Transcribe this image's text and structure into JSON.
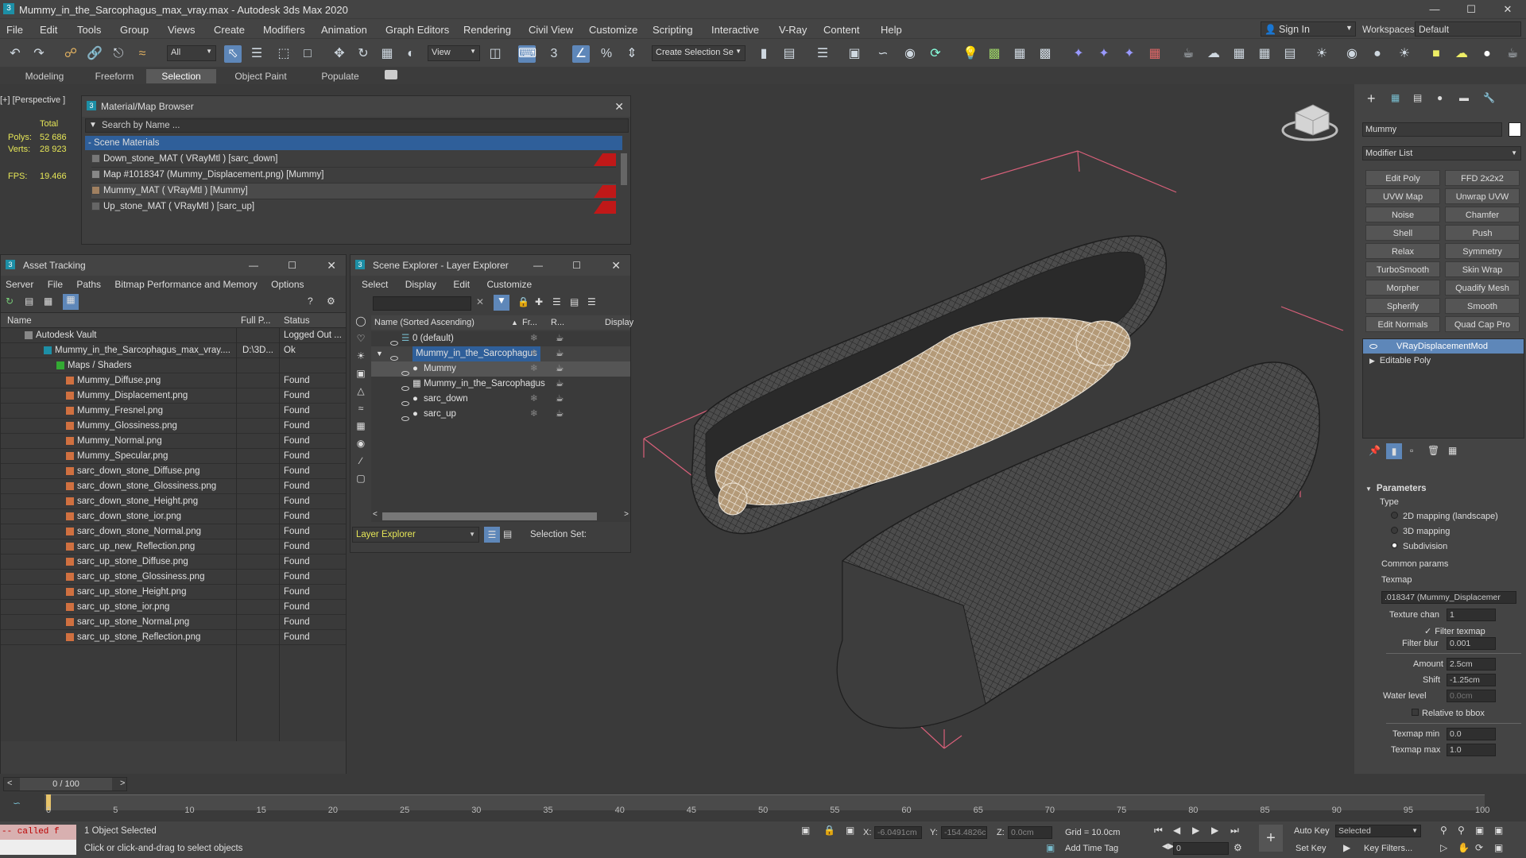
{
  "app": {
    "title": "Mummy_in_the_Sarcophagus_max_vray.max - Autodesk 3ds Max 2020"
  },
  "menu": [
    "File",
    "Edit",
    "Tools",
    "Group",
    "Views",
    "Create",
    "Modifiers",
    "Animation",
    "Graph Editors",
    "Rendering",
    "Civil View",
    "Customize",
    "Scripting",
    "Interactive",
    "V-Ray",
    "Content",
    "Help"
  ],
  "account": {
    "sign_in": "Sign In",
    "workspaces_label": "Workspaces:",
    "workspace": "Default"
  },
  "toolbar": {
    "filter": "All",
    "ref_coord": "View",
    "selection_set": "Create Selection Se"
  },
  "ribbon_tabs": [
    "Modeling",
    "Freeform",
    "Selection",
    "Object Paint",
    "Populate"
  ],
  "viewport": {
    "label": "[+] [Perspective ]",
    "stats": {
      "total": "Total",
      "polys_label": "Polys:",
      "polys": "52 686",
      "verts_label": "Verts:",
      "verts": "28 923",
      "fps_label": "FPS:",
      "fps": "19.466"
    }
  },
  "material_browser": {
    "title": "Material/Map Browser",
    "search_placeholder": "Search by Name ...",
    "group": "- Scene Materials",
    "items": [
      "Down_stone_MAT  ( VRayMtl ) [sarc_down]",
      "Map #1018347 (Mummy_Displacement.png) [Mummy]",
      "Mummy_MAT  ( VRayMtl ) [Mummy]",
      "Up_stone_MAT  ( VRayMtl ) [sarc_up]"
    ]
  },
  "asset_tracking": {
    "title": "Asset Tracking",
    "menu": [
      "Server",
      "File",
      "Paths",
      "Bitmap Performance and Memory",
      "Options"
    ],
    "columns": [
      "Name",
      "Full P...",
      "Status"
    ],
    "rows": [
      {
        "name": "Autodesk Vault",
        "path": "",
        "status": "Logged Out ..."
      },
      {
        "name": "Mummy_in_the_Sarcophagus_max_vray....",
        "path": "D:\\3D...",
        "status": "Ok"
      },
      {
        "name": "Maps / Shaders",
        "path": "",
        "status": ""
      },
      {
        "name": "Mummy_Diffuse.png",
        "path": "",
        "status": "Found"
      },
      {
        "name": "Mummy_Displacement.png",
        "path": "",
        "status": "Found"
      },
      {
        "name": "Mummy_Fresnel.png",
        "path": "",
        "status": "Found"
      },
      {
        "name": "Mummy_Glossiness.png",
        "path": "",
        "status": "Found"
      },
      {
        "name": "Mummy_Normal.png",
        "path": "",
        "status": "Found"
      },
      {
        "name": "Mummy_Specular.png",
        "path": "",
        "status": "Found"
      },
      {
        "name": "sarc_down_stone_Diffuse.png",
        "path": "",
        "status": "Found"
      },
      {
        "name": "sarc_down_stone_Glossiness.png",
        "path": "",
        "status": "Found"
      },
      {
        "name": "sarc_down_stone_Height.png",
        "path": "",
        "status": "Found"
      },
      {
        "name": "sarc_down_stone_ior.png",
        "path": "",
        "status": "Found"
      },
      {
        "name": "sarc_down_stone_Normal.png",
        "path": "",
        "status": "Found"
      },
      {
        "name": "sarc_up_new_Reflection.png",
        "path": "",
        "status": "Found"
      },
      {
        "name": "sarc_up_stone_Diffuse.png",
        "path": "",
        "status": "Found"
      },
      {
        "name": "sarc_up_stone_Glossiness.png",
        "path": "",
        "status": "Found"
      },
      {
        "name": "sarc_up_stone_Height.png",
        "path": "",
        "status": "Found"
      },
      {
        "name": "sarc_up_stone_ior.png",
        "path": "",
        "status": "Found"
      },
      {
        "name": "sarc_up_stone_Normal.png",
        "path": "",
        "status": "Found"
      },
      {
        "name": "sarc_up_stone_Reflection.png",
        "path": "",
        "status": "Found"
      }
    ]
  },
  "scene_explorer": {
    "title": "Scene Explorer - Layer Explorer",
    "menu": [
      "Select",
      "Display",
      "Edit",
      "Customize"
    ],
    "columns": [
      "Name (Sorted Ascending)",
      "Fr...",
      "R...",
      "Display"
    ],
    "rows": [
      "0 (default)",
      "Mummy_in_the_Sarcophagus",
      "Mummy",
      "Mummy_in_the_Sarcophagus",
      "sarc_down",
      "sarc_up"
    ],
    "footer_dropdown": "Layer Explorer",
    "selection_set_label": "Selection Set:"
  },
  "command_panel": {
    "object_name": "Mummy",
    "modifier_list": "Modifier List",
    "buttons": [
      "Edit Poly",
      "FFD 2x2x2",
      "UVW Map",
      "Unwrap UVW",
      "Noise",
      "Chamfer",
      "Shell",
      "Push",
      "Relax",
      "Symmetry",
      "TurboSmooth",
      "Skin Wrap",
      "Morpher",
      "Quadify Mesh",
      "Spherify",
      "Smooth",
      "Edit Normals",
      "Quad Cap Pro"
    ],
    "stack": [
      "VRayDisplacementMod",
      "Editable Poly"
    ],
    "params": {
      "header": "Parameters",
      "type_label": "Type",
      "type_options": [
        "2D mapping (landscape)",
        "3D mapping",
        "Subdivision"
      ],
      "common": "Common params",
      "texmap_label": "Texmap",
      "texmap": ".018347 (Mummy_Displacemer",
      "texture_chan_label": "Texture chan",
      "texture_chan": "1",
      "filter_texmap": "Filter texmap",
      "filter_blur_label": "Filter blur",
      "filter_blur": "0.001",
      "amount_label": "Amount",
      "amount": "2.5cm",
      "shift_label": "Shift",
      "shift": "-1.25cm",
      "water_label": "Water level",
      "water": "0.0cm",
      "relative": "Relative to bbox",
      "texmin_label": "Texmap min",
      "texmin": "0.0",
      "texmax_label": "Texmap max",
      "texmax": "1.0"
    }
  },
  "timeline": {
    "frame": "0 / 100",
    "ticks": [
      "0",
      "5",
      "10",
      "15",
      "20",
      "25",
      "30",
      "35",
      "40",
      "45",
      "50",
      "55",
      "60",
      "65",
      "70",
      "75",
      "80",
      "85",
      "90",
      "95",
      "100"
    ]
  },
  "status": {
    "maxscript": "-- called f",
    "selected": "1 Object Selected",
    "prompt": "Click or click-and-drag to select objects",
    "x_label": "X:",
    "x": "-6.0491cm",
    "y_label": "Y:",
    "y": "-154.4826c",
    "z_label": "Z:",
    "z": "0.0cm",
    "grid": "Grid = 10.0cm",
    "add_time_tag": "Add Time Tag",
    "auto_key": "Auto Key",
    "set_key": "Set Key",
    "selected_dd": "Selected",
    "key_filters": "Key Filters...",
    "frame_field": "0"
  },
  "colors": {
    "accent": "#5e87b9",
    "selection": "#2f5f9a",
    "bg": "#444444",
    "viewport": "#3a3a3a",
    "found_text": "#e0e0e0",
    "bbox": "#d9607a"
  }
}
